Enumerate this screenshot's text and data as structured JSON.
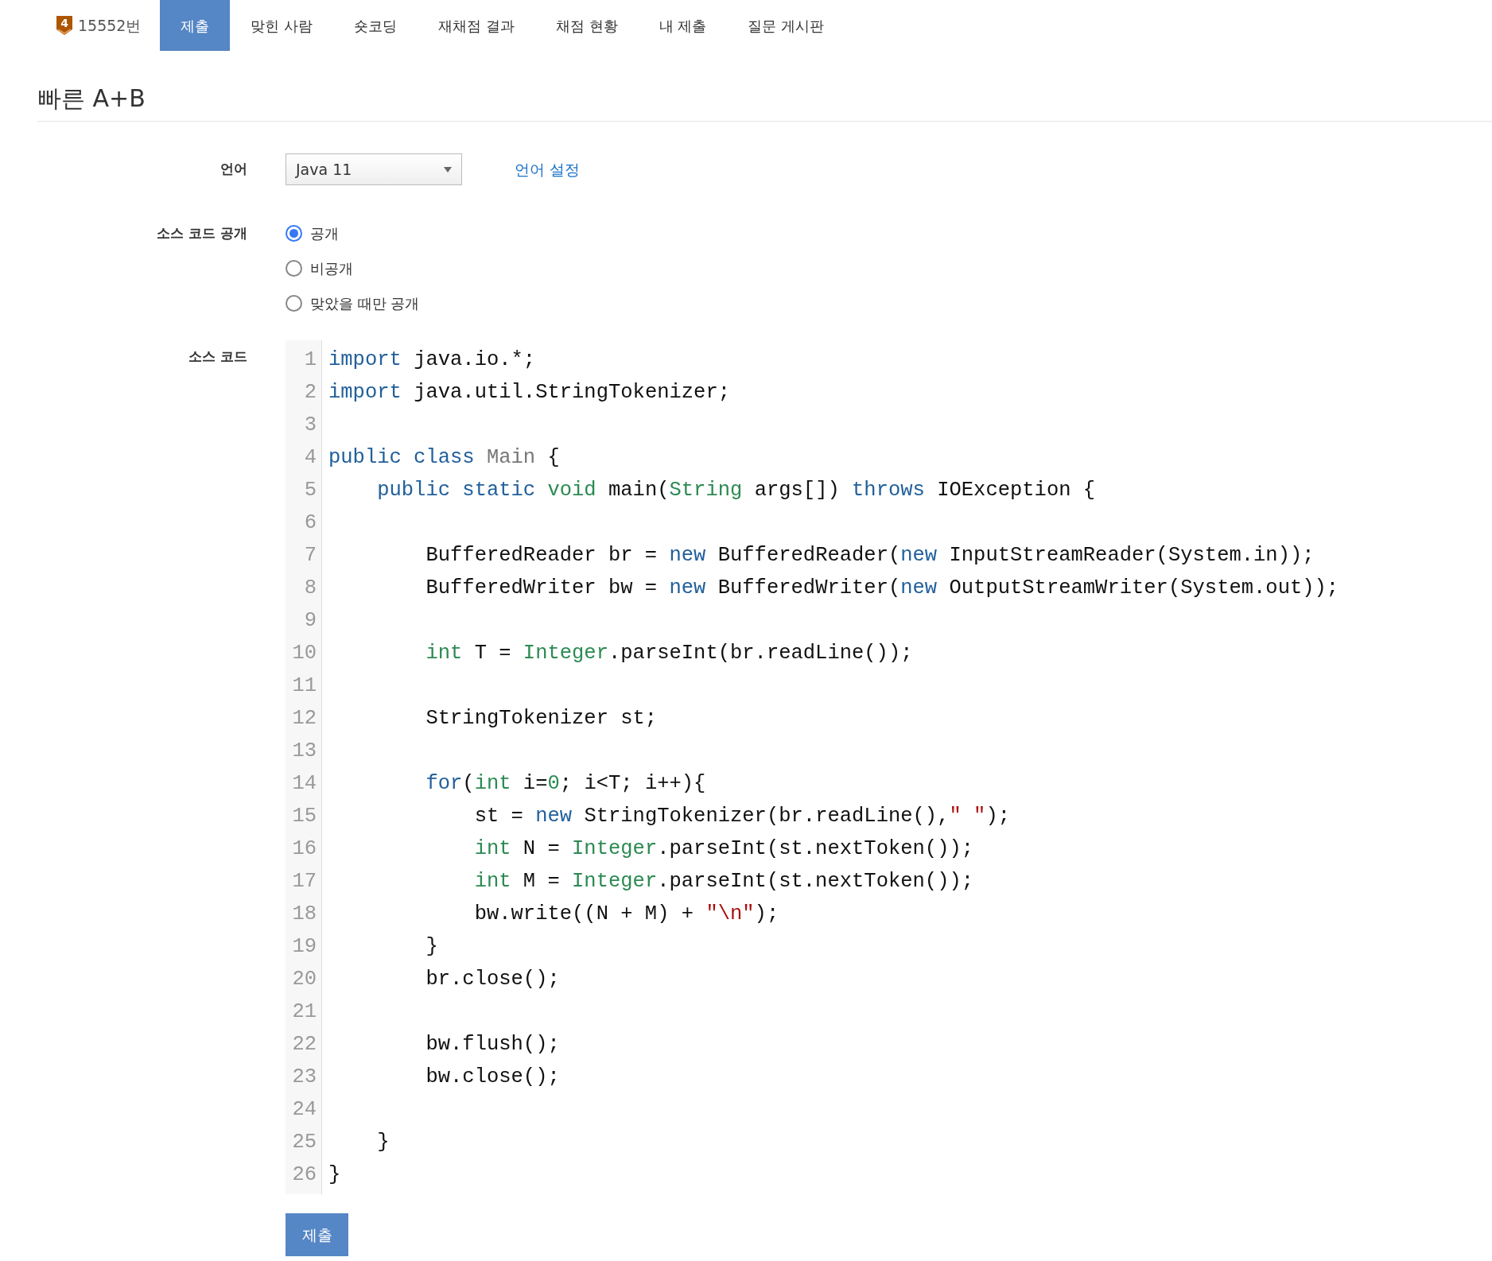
{
  "problem_nav": {
    "tier": "4",
    "number": "15552번",
    "tabs": [
      {
        "label": "제출",
        "selected": true
      },
      {
        "label": "맞힌 사람",
        "selected": false
      },
      {
        "label": "숏코딩",
        "selected": false
      },
      {
        "label": "재채점 결과",
        "selected": false
      },
      {
        "label": "채점 현황",
        "selected": false
      },
      {
        "label": "내 제출",
        "selected": false
      },
      {
        "label": "질문 게시판",
        "selected": false
      }
    ]
  },
  "title": "빠른 A+B",
  "form": {
    "language_label": "언어",
    "language_value": "Java 11",
    "language_settings_link": "언어 설정",
    "visibility_label": "소스 코드 공개",
    "visibility_options": [
      {
        "label": "공개",
        "selected": true
      },
      {
        "label": "비공개",
        "selected": false
      },
      {
        "label": "맞았을 때만 공개",
        "selected": false
      }
    ],
    "source_label": "소스 코드",
    "code_lines": [
      {
        "number": "1",
        "tokens": [
          {
            "kind": "keyword",
            "text": "import"
          },
          {
            "kind": "plain",
            "text": " java.io.*;"
          }
        ]
      },
      {
        "number": "2",
        "tokens": [
          {
            "kind": "keyword",
            "text": "import"
          },
          {
            "kind": "plain",
            "text": " java.util.StringTokenizer;"
          }
        ]
      },
      {
        "number": "3"
      },
      {
        "number": "4",
        "tokens": [
          {
            "kind": "keyword",
            "text": "public class "
          },
          {
            "kind": "def",
            "text": "Main"
          },
          {
            "kind": "plain",
            "text": " {"
          }
        ]
      },
      {
        "number": "5",
        "tokens": [
          {
            "kind": "keyword",
            "text": "    public static "
          },
          {
            "kind": "type",
            "text": "void"
          },
          {
            "kind": "plain",
            "text": " main("
          },
          {
            "kind": "type",
            "text": "String"
          },
          {
            "kind": "plain",
            "text": " args[]) "
          },
          {
            "kind": "keyword",
            "text": "throws"
          },
          {
            "kind": "plain",
            "text": " IOException {"
          }
        ]
      },
      {
        "number": "6"
      },
      {
        "number": "7",
        "tokens": [
          {
            "kind": "plain",
            "text": "        BufferedReader br = "
          },
          {
            "kind": "keyword",
            "text": "new"
          },
          {
            "kind": "plain",
            "text": " BufferedReader("
          },
          {
            "kind": "keyword",
            "text": "new"
          },
          {
            "kind": "plain",
            "text": " InputStreamReader(System.in));"
          }
        ]
      },
      {
        "number": "8",
        "tokens": [
          {
            "kind": "plain",
            "text": "        BufferedWriter bw = "
          },
          {
            "kind": "keyword",
            "text": "new"
          },
          {
            "kind": "plain",
            "text": " BufferedWriter("
          },
          {
            "kind": "keyword",
            "text": "new"
          },
          {
            "kind": "plain",
            "text": " OutputStreamWriter(System.out));"
          }
        ]
      },
      {
        "number": "9"
      },
      {
        "number": "10",
        "tokens": [
          {
            "kind": "type",
            "text": "        int"
          },
          {
            "kind": "plain",
            "text": " T = "
          },
          {
            "kind": "type",
            "text": "Integer"
          },
          {
            "kind": "plain",
            "text": ".parseInt(br.readLine());"
          }
        ]
      },
      {
        "number": "11"
      },
      {
        "number": "12",
        "tokens": [
          {
            "kind": "plain",
            "text": "        StringTokenizer st;"
          }
        ]
      },
      {
        "number": "13"
      },
      {
        "number": "14",
        "tokens": [
          {
            "kind": "keyword",
            "text": "        for"
          },
          {
            "kind": "plain",
            "text": "("
          },
          {
            "kind": "type",
            "text": "int"
          },
          {
            "kind": "plain",
            "text": " i="
          },
          {
            "kind": "number",
            "text": "0"
          },
          {
            "kind": "plain",
            "text": "; i<T; i++){"
          }
        ]
      },
      {
        "number": "15",
        "tokens": [
          {
            "kind": "plain",
            "text": "            st = "
          },
          {
            "kind": "keyword",
            "text": "new"
          },
          {
            "kind": "plain",
            "text": " StringTokenizer(br.readLine(),"
          },
          {
            "kind": "string",
            "text": "\" \""
          },
          {
            "kind": "plain",
            "text": ");"
          }
        ]
      },
      {
        "number": "16",
        "tokens": [
          {
            "kind": "type",
            "text": "            int"
          },
          {
            "kind": "plain",
            "text": " N = "
          },
          {
            "kind": "type",
            "text": "Integer"
          },
          {
            "kind": "plain",
            "text": ".parseInt(st.nextToken());"
          }
        ]
      },
      {
        "number": "17",
        "tokens": [
          {
            "kind": "type",
            "text": "            int"
          },
          {
            "kind": "plain",
            "text": " M = "
          },
          {
            "kind": "type",
            "text": "Integer"
          },
          {
            "kind": "plain",
            "text": ".parseInt(st.nextToken());"
          }
        ]
      },
      {
        "number": "18",
        "tokens": [
          {
            "kind": "plain",
            "text": "            bw.write((N + M) + "
          },
          {
            "kind": "string",
            "text": "\"\\n\""
          },
          {
            "kind": "plain",
            "text": ");"
          }
        ]
      },
      {
        "number": "19",
        "tokens": [
          {
            "kind": "plain",
            "text": "        }"
          }
        ]
      },
      {
        "number": "20",
        "tokens": [
          {
            "kind": "plain",
            "text": "        br.close();"
          }
        ]
      },
      {
        "number": "21"
      },
      {
        "number": "22",
        "tokens": [
          {
            "kind": "plain",
            "text": "        bw.flush();"
          }
        ]
      },
      {
        "number": "23",
        "tokens": [
          {
            "kind": "plain",
            "text": "        bw.close();"
          }
        ]
      },
      {
        "number": "24"
      },
      {
        "number": "25",
        "tokens": [
          {
            "kind": "plain",
            "text": "    }"
          }
        ]
      },
      {
        "number": "26",
        "tokens": [
          {
            "kind": "plain",
            "text": "}"
          }
        ]
      }
    ],
    "submit_button": "제출"
  }
}
